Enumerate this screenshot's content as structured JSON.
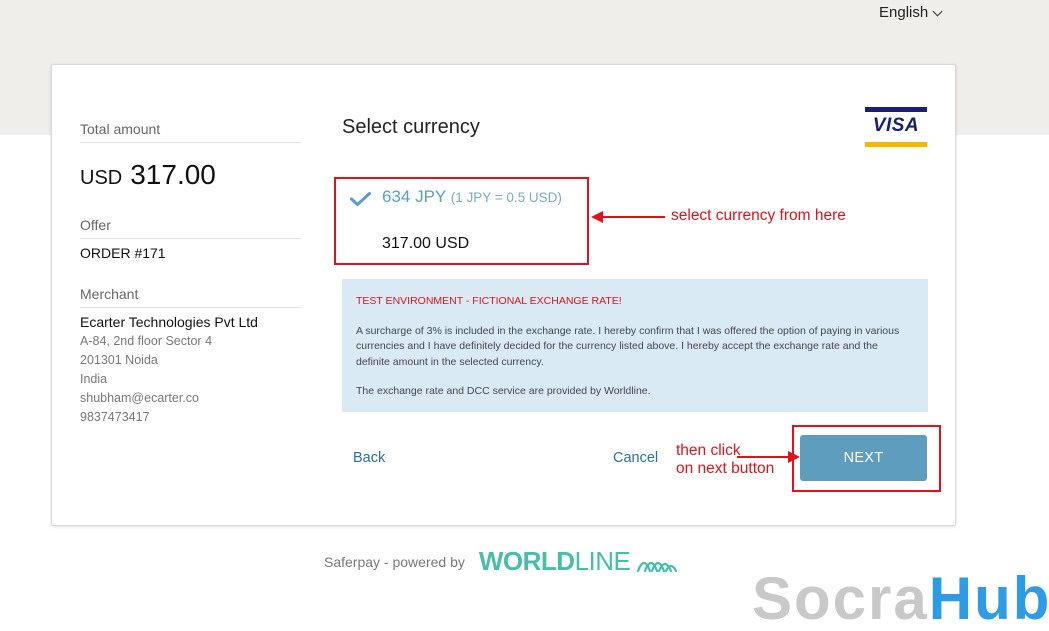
{
  "language": {
    "selected": "English"
  },
  "summary": {
    "total_label": "Total amount",
    "currency": "USD",
    "amount": "317.00",
    "offer_label": "Offer",
    "offer_value": "ORDER #171",
    "merchant_label": "Merchant",
    "merchant_name": "Ecarter Technologies Pvt Ltd",
    "merchant_lines": [
      "A-84, 2nd floor Sector 4",
      "201301 Noida",
      "India",
      "shubham@ecarter.co",
      "9837473417"
    ]
  },
  "main": {
    "title": "Select currency",
    "card_brand": "VISA",
    "option": {
      "amount": "634 JPY",
      "rate": "(1 JPY = 0.5 USD)",
      "original": "317.00 USD"
    },
    "notice": {
      "warning": "TEST ENVIRONMENT - FICTIONAL EXCHANGE RATE!",
      "body": "A surcharge of 3% is included in the exchange rate. I hereby confirm that I was offered the option of paying in various currencies and I have definitely decided for the currency listed above. I hereby accept the exchange rate and the definite amount in the selected currency.",
      "provider": "The exchange rate and DCC service are provided by Worldline."
    },
    "back_label": "Back",
    "cancel_label": "Cancel",
    "next_label": "NEXT"
  },
  "annotations": {
    "select": "select currency from here",
    "next_line1": "then click",
    "next_line2": "on next button"
  },
  "footer": {
    "powered": "Saferpay - powered by",
    "logo_bold": "WORLD",
    "logo_light": "LINE"
  },
  "watermark": {
    "part1": "Socra",
    "part2": "Hub"
  },
  "colors": {
    "accent": "#5e9dbd",
    "link": "#2b6ca3",
    "annotation": "#e0121b",
    "notice_bg": "#daeaf4",
    "worldline": "#46beaa"
  }
}
